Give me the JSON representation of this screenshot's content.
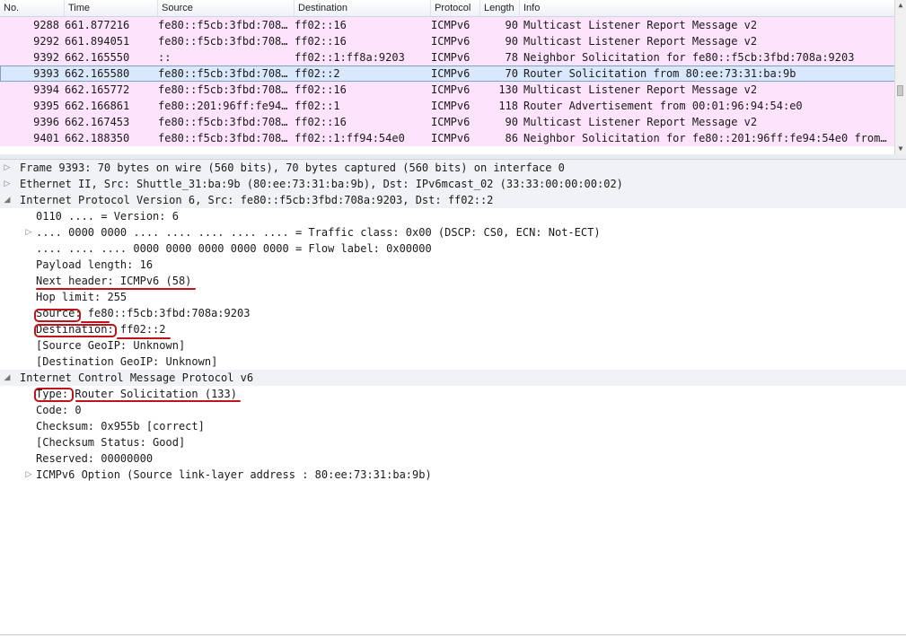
{
  "packet_list": {
    "columns": [
      "No.",
      "Time",
      "Source",
      "Destination",
      "Protocol",
      "Length",
      "Info"
    ],
    "rows": [
      {
        "no": "9288",
        "time": "661.877216",
        "source": "fe80::f5cb:3fbd:708…",
        "destination": "ff02::16",
        "protocol": "ICMPv6",
        "length": "90",
        "info": "Multicast Listener Report Message v2"
      },
      {
        "no": "9292",
        "time": "661.894051",
        "source": "fe80::f5cb:3fbd:708…",
        "destination": "ff02::16",
        "protocol": "ICMPv6",
        "length": "90",
        "info": "Multicast Listener Report Message v2"
      },
      {
        "no": "9392",
        "time": "662.165550",
        "source": "::",
        "destination": "ff02::1:ff8a:9203",
        "protocol": "ICMPv6",
        "length": "78",
        "info": "Neighbor Solicitation for fe80::f5cb:3fbd:708a:9203"
      },
      {
        "no": "9393",
        "time": "662.165580",
        "source": "fe80::f5cb:3fbd:708…",
        "destination": "ff02::2",
        "protocol": "ICMPv6",
        "length": "70",
        "info": "Router Solicitation from 80:ee:73:31:ba:9b"
      },
      {
        "no": "9394",
        "time": "662.165772",
        "source": "fe80::f5cb:3fbd:708…",
        "destination": "ff02::16",
        "protocol": "ICMPv6",
        "length": "130",
        "info": "Multicast Listener Report Message v2"
      },
      {
        "no": "9395",
        "time": "662.166861",
        "source": "fe80::201:96ff:fe94…",
        "destination": "ff02::1",
        "protocol": "ICMPv6",
        "length": "118",
        "info": "Router Advertisement from 00:01:96:94:54:e0"
      },
      {
        "no": "9396",
        "time": "662.167453",
        "source": "fe80::f5cb:3fbd:708…",
        "destination": "ff02::16",
        "protocol": "ICMPv6",
        "length": "90",
        "info": "Multicast Listener Report Message v2"
      },
      {
        "no": "9401",
        "time": "662.188350",
        "source": "fe80::f5cb:3fbd:708…",
        "destination": "ff02::1:ff94:54e0",
        "protocol": "ICMPv6",
        "length": "86",
        "info": "Neighbor Solicitation for fe80::201:96ff:fe94:54e0 from…"
      }
    ],
    "selected_no": "9393"
  },
  "details": [
    {
      "text": "Frame 9393: 70 bytes on wire (560 bits), 70 bytes captured (560 bits) on interface 0",
      "level": 0,
      "toggle": "collapsed",
      "section": true
    },
    {
      "text": "Ethernet II, Src: Shuttle_31:ba:9b (80:ee:73:31:ba:9b), Dst: IPv6mcast_02 (33:33:00:00:00:02)",
      "level": 0,
      "toggle": "collapsed",
      "section": true
    },
    {
      "text": "Internet Protocol Version 6, Src: fe80::f5cb:3fbd:708a:9203, Dst: ff02::2",
      "level": 0,
      "toggle": "expanded",
      "section": true
    },
    {
      "text": "0110 .... = Version: 6",
      "level": 1,
      "toggle": "none"
    },
    {
      "text": ".... 0000 0000 .... .... .... .... .... = Traffic class: 0x00 (DSCP: CS0, ECN: Not-ECT)",
      "level": 1,
      "toggle": "collapsed"
    },
    {
      "text": ".... .... .... 0000 0000 0000 0000 0000 = Flow label: 0x00000",
      "level": 1,
      "toggle": "none"
    },
    {
      "text": "Payload length: 16",
      "level": 1,
      "toggle": "none"
    },
    {
      "text": "Next header: ICMPv6 (58)",
      "level": 1,
      "toggle": "none"
    },
    {
      "text": "Hop limit: 255",
      "level": 1,
      "toggle": "none"
    },
    {
      "text": "Source: fe80::f5cb:3fbd:708a:9203",
      "level": 1,
      "toggle": "none"
    },
    {
      "text": "Destination: ff02::2",
      "level": 1,
      "toggle": "none"
    },
    {
      "text": "[Source GeoIP: Unknown]",
      "level": 1,
      "toggle": "none"
    },
    {
      "text": "[Destination GeoIP: Unknown]",
      "level": 1,
      "toggle": "none"
    },
    {
      "text": "Internet Control Message Protocol v6",
      "level": 0,
      "toggle": "expanded",
      "section": true
    },
    {
      "text": "Type: Router Solicitation (133)",
      "level": 1,
      "toggle": "none"
    },
    {
      "text": "Code: 0",
      "level": 1,
      "toggle": "none"
    },
    {
      "text": "Checksum: 0x955b [correct]",
      "level": 1,
      "toggle": "none"
    },
    {
      "text": "[Checksum Status: Good]",
      "level": 1,
      "toggle": "none"
    },
    {
      "text": "Reserved: 00000000",
      "level": 1,
      "toggle": "none"
    },
    {
      "text": "ICMPv6 Option (Source link-layer address : 80:ee:73:31:ba:9b)",
      "level": 1,
      "toggle": "collapsed"
    }
  ],
  "icons": {
    "collapsed": "triangle-right-icon",
    "expanded": "triangle-down-icon"
  },
  "colors": {
    "row_bg": "#fde3fb",
    "selected_bg": "#d9e8fb",
    "annotation": "#c0141b"
  }
}
